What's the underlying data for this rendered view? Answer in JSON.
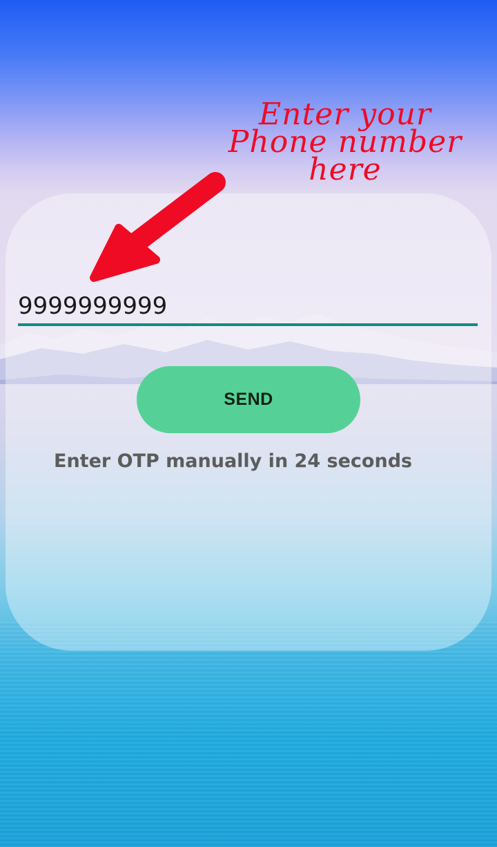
{
  "phone_form": {
    "phone_value": "9999999999",
    "send_label": "SEND",
    "otp_message": "Enter OTP manually in 24 seconds"
  },
  "annotation": {
    "lines": [
      "Enter your",
      "Phone number",
      "here"
    ],
    "color": "#ef0b24"
  },
  "colors": {
    "send_button": "#55d197",
    "input_underline": "#128c7e"
  },
  "icons": {
    "arrow": "arrow-down-left-icon"
  }
}
